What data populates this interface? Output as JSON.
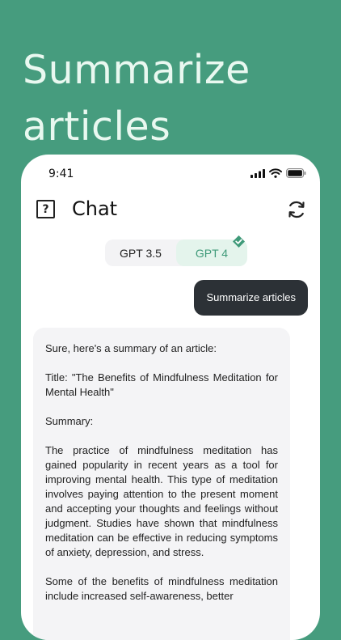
{
  "headline": [
    "Summarize",
    "articles"
  ],
  "status": {
    "time": "9:41"
  },
  "nav": {
    "help_glyph": "?",
    "title": "Chat"
  },
  "icons": {
    "help": "help-icon",
    "refresh": "refresh-icon",
    "selected": "check-badge-icon"
  },
  "models": [
    {
      "label": "GPT 3.5",
      "selected": false
    },
    {
      "label": "GPT 4",
      "selected": true
    }
  ],
  "user_message": "Summarize articles",
  "bot_message": {
    "intro": "Sure, here's a summary of an article:",
    "title_line": "Title: \"The Benefits of Mindfulness Meditation for Mental Health\"",
    "summary_label": "Summary:",
    "paragraph_1": "The practice of mindfulness meditation has gained popularity in recent years as a tool for improving mental health. This type of meditation involves paying attention to the present moment and accepting your thoughts and feelings without judgment. Studies have shown that mindfulness meditation can be effective in reducing symptoms of anxiety, depression, and stress.",
    "paragraph_2": "Some of the benefits of mindfulness meditation include increased self-awareness, better"
  },
  "colors": {
    "background": "#469c7e",
    "accent": "#3f9a79",
    "user_bubble": "#2c3136",
    "bot_bubble": "#f4f4f6"
  }
}
